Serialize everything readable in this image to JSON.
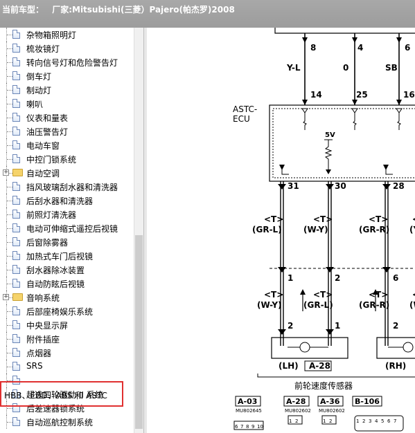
{
  "header": {
    "label": "当前车型：",
    "vehicle": "厂家:Mitsubishi(三菱）Pajero(帕杰罗)2008"
  },
  "tree": {
    "items": [
      {
        "label": "杂物箱照明灯",
        "type": "doc"
      },
      {
        "label": "梳妆镜灯",
        "type": "doc"
      },
      {
        "label": "转向信号灯和危险警告灯",
        "type": "doc"
      },
      {
        "label": "倒车灯",
        "type": "doc"
      },
      {
        "label": "制动灯",
        "type": "doc"
      },
      {
        "label": "喇叭",
        "type": "doc"
      },
      {
        "label": "仪表和量表",
        "type": "doc"
      },
      {
        "label": "油压警告灯",
        "type": "doc"
      },
      {
        "label": "电动车窗",
        "type": "doc"
      },
      {
        "label": "中控门锁系统",
        "type": "doc"
      },
      {
        "label": "自动空调",
        "type": "folder"
      },
      {
        "label": "挡风玻璃刮水器和清洗器",
        "type": "doc"
      },
      {
        "label": "后刮水器和清洗器",
        "type": "doc"
      },
      {
        "label": "前照灯清洗器",
        "type": "doc"
      },
      {
        "label": "电动可伸缩式遥控后视镜",
        "type": "doc"
      },
      {
        "label": "后窗除雾器",
        "type": "doc"
      },
      {
        "label": "加热式车门后视镜",
        "type": "doc"
      },
      {
        "label": "刮水器除冰装置",
        "type": "doc"
      },
      {
        "label": "自动防眩后视镜",
        "type": "doc"
      },
      {
        "label": "音响系统",
        "type": "folder"
      },
      {
        "label": "后部座椅娱乐系统",
        "type": "doc"
      },
      {
        "label": "中央显示屏",
        "type": "doc"
      },
      {
        "label": "附件插座",
        "type": "doc"
      },
      {
        "label": "点烟器",
        "type": "doc"
      },
      {
        "label": "SRS",
        "type": "doc"
      },
      {
        "label": "",
        "type": "doc"
      },
      {
        "label": "超选四轮驱动 II 系统",
        "type": "doc"
      },
      {
        "label": "后差速器锁系统",
        "type": "doc"
      },
      {
        "label": "自动巡航控制系统",
        "type": "doc"
      }
    ],
    "highlight_label": "HBB、EBD、ABS 和 ASTC"
  },
  "diagram": {
    "top_pins": [
      "8",
      "4",
      "6"
    ],
    "wire_colors_top": [
      "Y-L",
      "0",
      "SB"
    ],
    "ecu_label_1": "ASTC-",
    "ecu_label_2": "ECU",
    "ecu_pins_top": [
      "14",
      "25",
      "16"
    ],
    "supply": "5V",
    "ecu_pins_bottom": [
      "31",
      "30",
      "28"
    ],
    "t_label": "<T>",
    "wire_colors_mid": [
      "(GR-L)",
      "(W-Y)",
      "(GR-R)",
      "(Y"
    ],
    "conn_pins_a": [
      "1",
      "2",
      "6"
    ],
    "wire_colors_low": [
      "(W-Y)",
      "(GR-L)",
      "(GR-R)",
      "(W"
    ],
    "conn_pins_b": [
      "2",
      "1",
      "2"
    ],
    "lh": "(LH)",
    "lh_conn": "A-28",
    "rh": "(RH)",
    "sensor_caption": "前轮速度传感器",
    "connectors": [
      {
        "id": "A-03",
        "part": "MU802645",
        "pins": [
          "6",
          "7",
          "8",
          "9",
          "10"
        ]
      },
      {
        "id": "A-28",
        "part": "MU802602",
        "pins": [
          "1",
          "2"
        ]
      },
      {
        "id": "A-36",
        "part": "MU802602",
        "pins": [
          "1",
          "2"
        ]
      },
      {
        "id": "B-106",
        "part": "",
        "pins": [
          "1",
          "2",
          "3",
          "4",
          "5",
          "6",
          "7"
        ]
      }
    ]
  }
}
